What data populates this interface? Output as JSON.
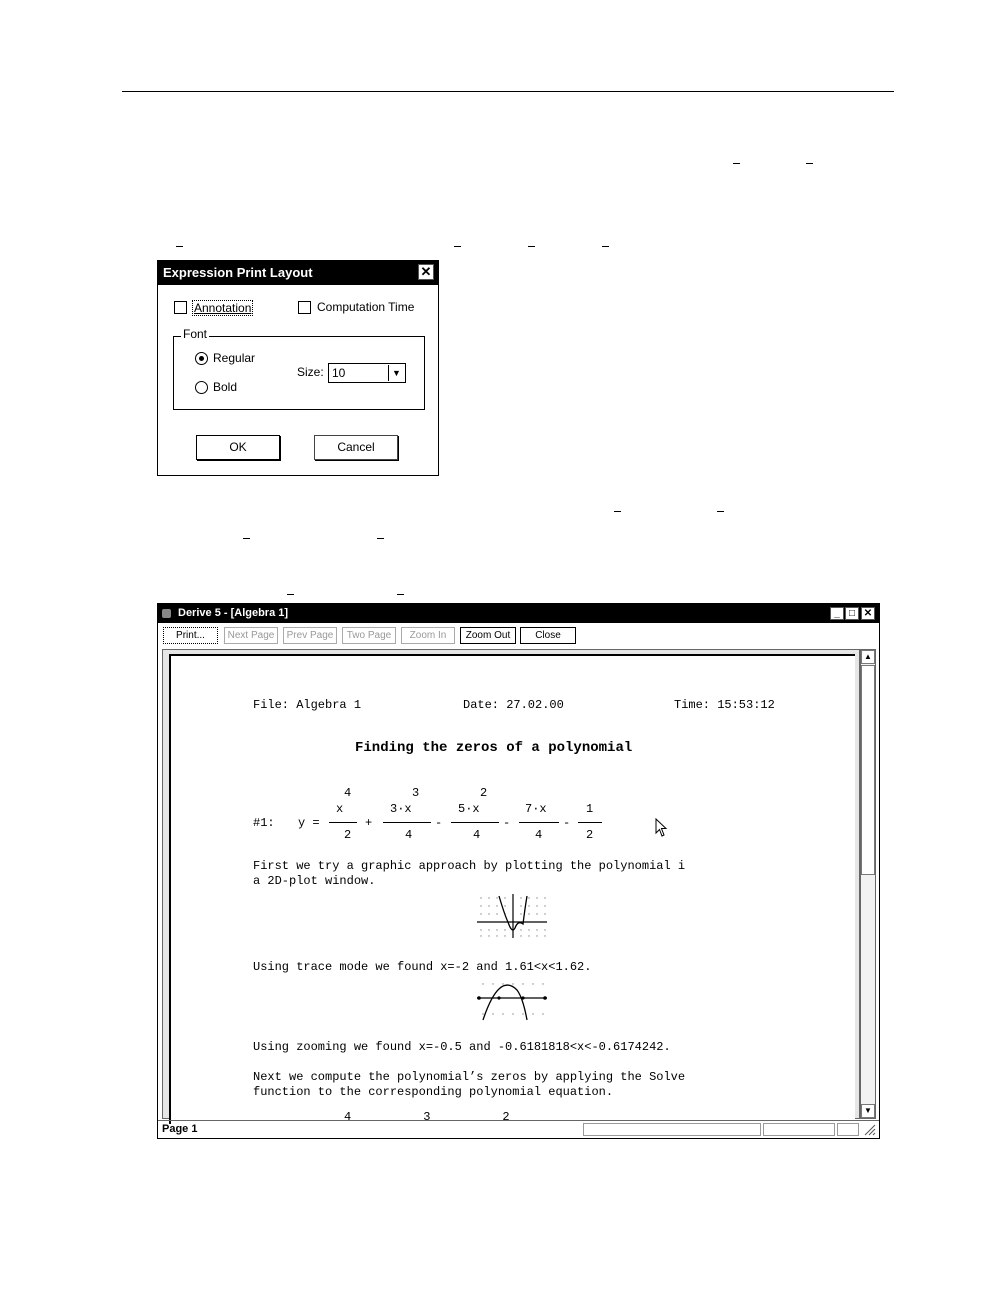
{
  "dialog": {
    "title": "Expression Print Layout",
    "close_glyph": "✕",
    "annotation_label": "Annotation",
    "annotation_checked": false,
    "computation_time_label": "Computation Time",
    "computation_time_checked": false,
    "font_group_label": "Font",
    "regular_label": "Regular",
    "bold_label": "Bold",
    "font_selected": "Regular",
    "size_label": "Size:",
    "size_value": "10",
    "ok_label": "OK",
    "cancel_label": "Cancel"
  },
  "window": {
    "title": "Derive 5 - [Algebra 1]",
    "toolbar": {
      "print": "Print...",
      "next_page": "Next Page",
      "prev_page": "Prev Page",
      "two_page": "Two Page",
      "zoom_in": "Zoom In",
      "zoom_out": "Zoom Out",
      "close": "Close"
    },
    "status": {
      "page": "Page 1"
    }
  },
  "document": {
    "file": "File: Algebra 1",
    "date": "Date: 27.02.00",
    "time": "Time: 15:53:12",
    "heading": "Finding the zeros of a polynomial",
    "expr_label": "#1:",
    "expr_lhs": "y =",
    "terms": [
      {
        "num": "x",
        "exp": "4",
        "den": "2",
        "op": "+"
      },
      {
        "num": "3·x",
        "exp": "3",
        "den": "4",
        "op": "-"
      },
      {
        "num": "5·x",
        "exp": "2",
        "den": "4",
        "op": "-"
      },
      {
        "num": "7·x",
        "exp": "",
        "den": "4",
        "op": "-"
      },
      {
        "num": "1",
        "exp": "",
        "den": "2",
        "op": ""
      }
    ],
    "para1_line1": "First we try a graphic approach by plotting the polynomial i",
    "para1_line2": "a 2D-plot window.",
    "para2": "Using trace mode we found x=-2 and 1.61<x<1.62.",
    "para3": "Using zooming we found x=-0.5 and -0.6181818<x<-0.6174242.",
    "para4_line1": "Next we compute the polynomial’s zeros by applying the Solve",
    "para4_line2": "function to the corresponding polynomial equation.",
    "cut_line": "4          3          2"
  }
}
